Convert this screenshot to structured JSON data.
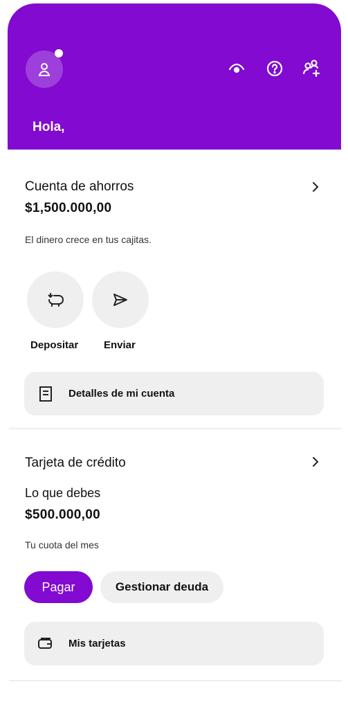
{
  "header": {
    "greeting": "Hola,",
    "color": "#820ad1",
    "icons": [
      "person-icon",
      "eye-icon",
      "help-icon",
      "add-friend-icon"
    ]
  },
  "savings": {
    "title": "Cuenta de ahorros",
    "balance": "$1,500.000,00",
    "subtitle": "El dinero crece en tus cajitas.",
    "actions": [
      {
        "label": "Depositar",
        "icon": "piggy-bank-icon"
      },
      {
        "label": "Enviar",
        "icon": "send-icon"
      }
    ],
    "details_label": "Detalles de mi cuenta"
  },
  "credit": {
    "title": "Tarjeta de crédito",
    "owed_label": "Lo que debes",
    "owed_amount": "$500.000,00",
    "monthly_label": "Tu cuota del mes",
    "pay_label": "Pagar",
    "manage_label": "Gestionar deuda",
    "cards_label": "Mis tarjetas"
  }
}
